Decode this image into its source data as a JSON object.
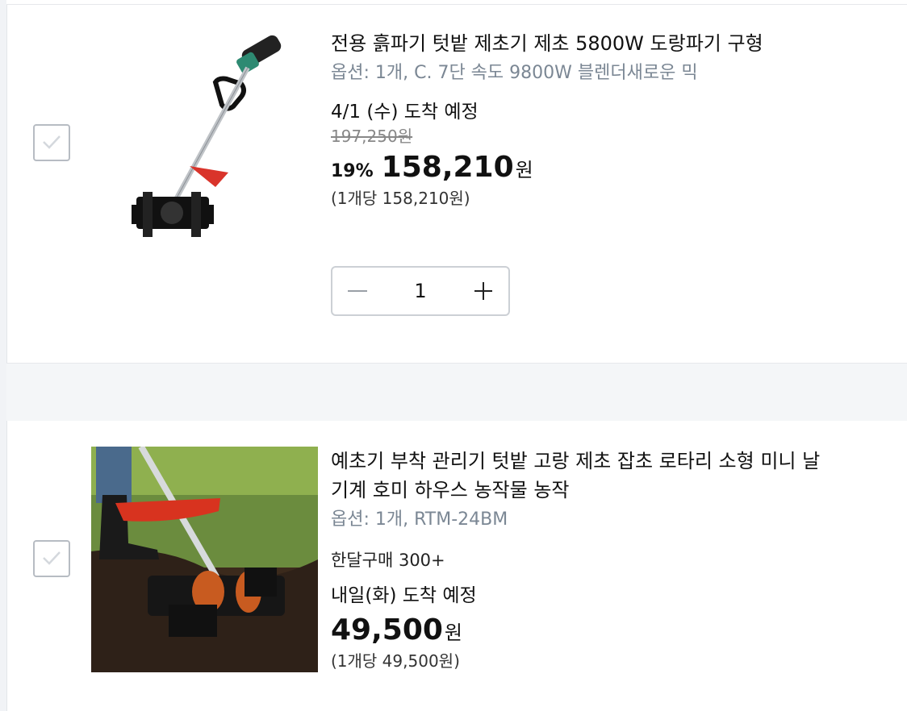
{
  "items": [
    {
      "title": "전용 흙파기 텃밭 제초기 제초 5800W 도랑파기 구형",
      "option": "옵션: 1개, C. 7단 속도 9800W 블렌더새로운 믹",
      "arrival": "4/1 (수) 도착 예정",
      "original_price": "197,250원",
      "discount": "19%",
      "price": "158,210",
      "currency": "원",
      "unit_price": "(1개당 158,210원)",
      "quantity": "1",
      "checked": true
    },
    {
      "title_line1": "예초기 부착 관리기 텃밭 고랑 제초 잡초 로타리 소형 미니 날",
      "title_line2": "기계 호미 하우스 농작물 농작",
      "option": "옵션: 1개, RTM-24BM",
      "monthly_purchases": "한달구매 300+",
      "arrival": "내일(화) 도착 예정",
      "price": "49,500",
      "currency": "원",
      "unit_price": "(1개당 49,500원)",
      "checked": true
    }
  ],
  "colors": {
    "checkbox_border": "#b7bcc3",
    "option_text": "#7b8794",
    "divider": "#f4f6f8"
  },
  "icons": {
    "checkbox": "checkmark-icon",
    "minus": "minus-icon",
    "plus": "plus-icon"
  }
}
